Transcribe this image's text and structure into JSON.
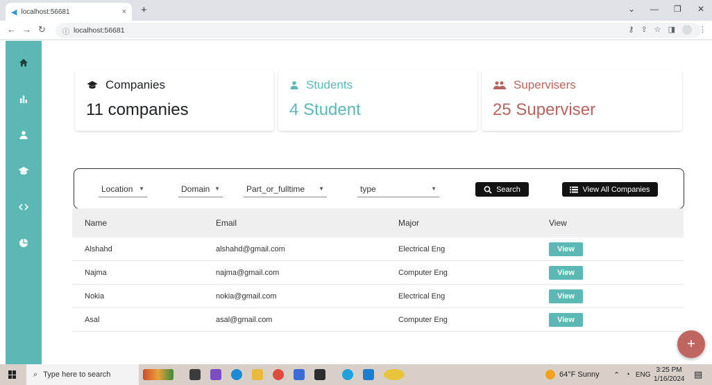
{
  "browser": {
    "tab_title": "localhost:56681",
    "tab_close": "×",
    "new_tab": "+",
    "url": "localhost:56681",
    "win_minimize": "—",
    "win_restore": "❐",
    "win_close": "✕",
    "win_menu": "⌄"
  },
  "nav_icons": [
    "home-icon",
    "bar-chart-icon",
    "person-icon",
    "school-icon",
    "code-icon",
    "pie-chart-icon"
  ],
  "stats": {
    "companies": {
      "label": "Companies",
      "value": "11 companies",
      "color": "#202124"
    },
    "students": {
      "label": "Students",
      "value": "4 Student",
      "color": "#5bb8b4"
    },
    "supervisers": {
      "label": "Supervisers",
      "value": "25 Superviser",
      "color": "#b5655f"
    }
  },
  "filters": {
    "location": "Location",
    "domain": "Domain",
    "part_or_fulltime": "Part_or_fulltime",
    "type": "type",
    "search_label": "Search",
    "view_all_label": "View All Companies"
  },
  "table": {
    "headers": [
      "Name",
      "Email",
      "Major",
      "View"
    ],
    "rows": [
      {
        "name": "Alshahd",
        "email": "alshahd@gmail.com",
        "major": "Electrical Eng",
        "action": "View"
      },
      {
        "name": "Najma",
        "email": "najma@gmail.com",
        "major": "Computer Eng",
        "action": "View"
      },
      {
        "name": "Nokia",
        "email": "nokia@gmail.com",
        "major": "Electrical Eng",
        "action": "View"
      },
      {
        "name": "Asal",
        "email": "asal@gmail.com",
        "major": "Computer Eng",
        "action": "View"
      }
    ]
  },
  "fab": {
    "label": "+"
  },
  "taskbar": {
    "search_placeholder": "Type here to search",
    "weather": "64°F Sunny",
    "language": "ENG",
    "time": "3:25 PM",
    "date": "1/16/2024"
  },
  "colors": {
    "accent": "#5bb8b4",
    "supervisor": "#b5655f",
    "fab": "#c0655f",
    "dark_button": "#121212"
  }
}
